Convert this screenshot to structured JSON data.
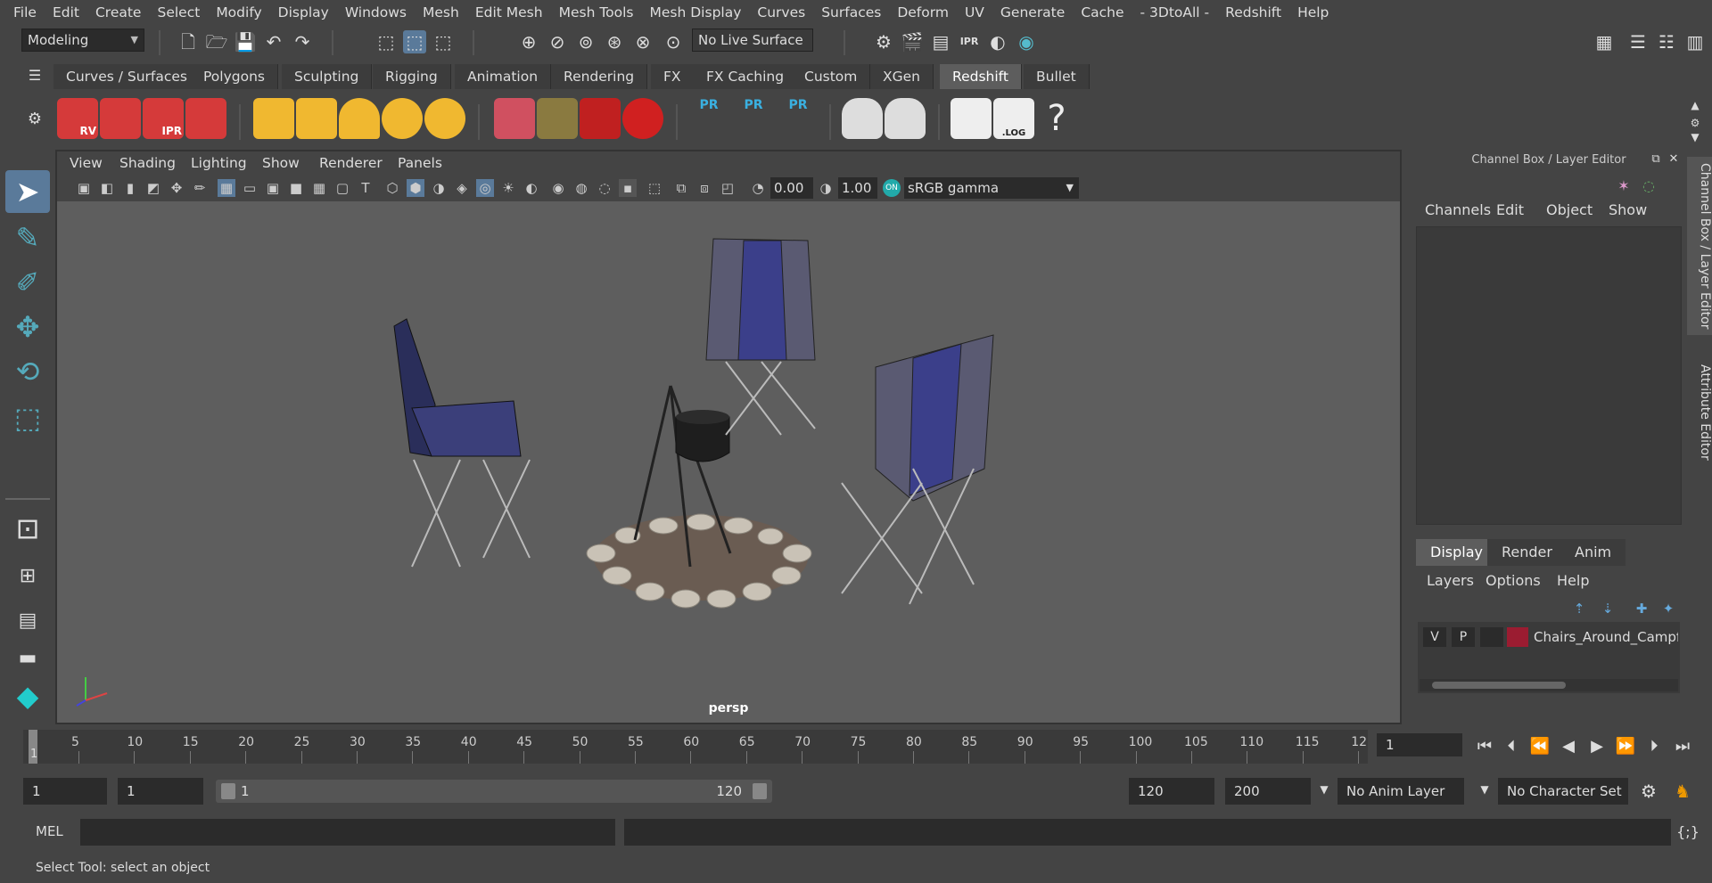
{
  "menubar": [
    "File",
    "Edit",
    "Create",
    "Select",
    "Modify",
    "Display",
    "Windows",
    "Mesh",
    "Edit Mesh",
    "Mesh Tools",
    "Mesh Display",
    "Curves",
    "Surfaces",
    "Deform",
    "UV",
    "Generate",
    "Cache",
    "- 3DtoAll -",
    "Redshift",
    "Help"
  ],
  "status": {
    "workspace": "Modeling",
    "live_surface": "No Live Surface"
  },
  "shelf_tabs": [
    "Curves / Surfaces",
    "Polygons",
    "Sculpting",
    "Rigging",
    "Animation",
    "Rendering",
    "FX",
    "FX Caching",
    "Custom",
    "XGen",
    "Redshift",
    "Bullet"
  ],
  "shelf_active": "Redshift",
  "shelf_icon_labels": {
    "rv": "RV",
    "ipr": "IPR",
    "pr": "PR",
    "log": ".LOG",
    "help": "?"
  },
  "viewport": {
    "menu": [
      "View",
      "Shading",
      "Lighting",
      "Show",
      "Renderer",
      "Panels"
    ],
    "exposure": "0.00",
    "gamma": "1.00",
    "colorspace": "sRGB gamma",
    "camera": "persp"
  },
  "channel_box": {
    "title": "Channel Box / Layer Editor",
    "menu": [
      "Channels",
      "Edit",
      "Object",
      "Show"
    ]
  },
  "layer_editor": {
    "tabs": [
      "Display",
      "Render",
      "Anim"
    ],
    "active_tab": "Display",
    "menu": [
      "Layers",
      "Options",
      "Help"
    ],
    "layer": {
      "v": "V",
      "p": "P",
      "name": "Chairs_Around_Campf",
      "color": "#9b1c31"
    }
  },
  "side_tabs": [
    "Channel Box / Layer Editor",
    "Attribute Editor"
  ],
  "timeline": {
    "ticks": [
      "5",
      "10",
      "15",
      "20",
      "25",
      "30",
      "35",
      "40",
      "45",
      "50",
      "55",
      "60",
      "65",
      "70",
      "75",
      "80",
      "85",
      "90",
      "95",
      "100",
      "105",
      "110",
      "115",
      "12"
    ],
    "current": "1",
    "current_field": "1"
  },
  "range": {
    "start": "1",
    "playback_start": "1",
    "slider_start": "1",
    "slider_end": "120",
    "playback_end": "120",
    "end": "200",
    "anim_layer": "No Anim Layer",
    "char_set": "No Character Set"
  },
  "cmdline": {
    "label": "MEL"
  },
  "help_line": "Select Tool: select an object"
}
